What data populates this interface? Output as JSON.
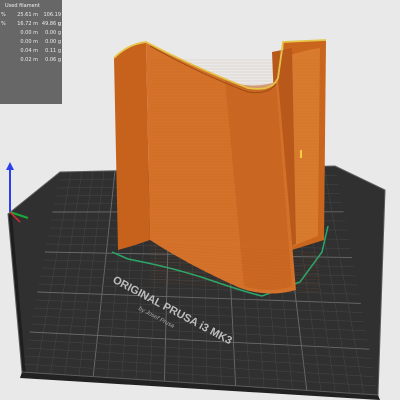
{
  "viewer": {
    "colors": {
      "background": "#e9e9e9",
      "bed": "#2a2a2a",
      "print": "#d06b20"
    }
  },
  "filament_panel": {
    "header": "Used filament",
    "rows": [
      {
        "marker": "%",
        "length": "25.61 m",
        "weight": "106.19 g"
      },
      {
        "marker": "%",
        "length": "16.72 m",
        "weight": "49.86 g"
      },
      {
        "marker": "",
        "length": "0.00 m",
        "weight": "0.00 g"
      },
      {
        "marker": "",
        "length": "0.00 m",
        "weight": "0.00 g"
      },
      {
        "marker": "",
        "length": "0.04 m",
        "weight": "0.11 g"
      },
      {
        "marker": "",
        "length": "0.02 m",
        "weight": "0.06 g"
      }
    ]
  },
  "bed_label": {
    "logo": "ORIGINAL PRUSA i3 MK3",
    "sub": "by Josef Prusa"
  }
}
